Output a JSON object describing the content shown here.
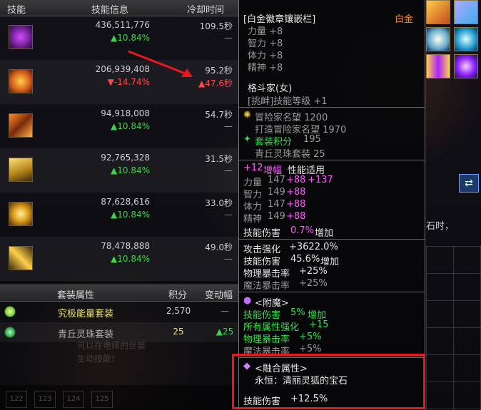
{
  "colors": {
    "accent_green": "#35e04a",
    "accent_red": "#ff4a4a",
    "pink": "#ff5cff",
    "gold": "#e8c35a",
    "highlight": "#e8191e"
  },
  "skill_table": {
    "headers": {
      "skill": "技能",
      "info": "技能信息",
      "cooldown": "冷却时间"
    },
    "rows": [
      {
        "icon": "purple-claw-icon",
        "damage": "436,511,776",
        "pct": "▲10.84%",
        "cd": "109.5秒",
        "cd_change": "—"
      },
      {
        "icon": "fire-burst-icon",
        "damage": "206,939,408",
        "pct": "▼-14.74%",
        "cd": "95.2秒",
        "cd_change": "▲47.6秒"
      },
      {
        "icon": "flame-fist-icon",
        "damage": "94,918,008",
        "pct": "▲10.84%",
        "cd": "54.7秒",
        "cd_change": "—"
      },
      {
        "icon": "golden-claw-icon",
        "damage": "92,765,328",
        "pct": "▲10.84%",
        "cd": "31.5秒",
        "cd_change": "—"
      },
      {
        "icon": "sun-star-icon",
        "damage": "87,628,616",
        "pct": "▲10.84%",
        "cd": "33.0秒",
        "cd_change": "—"
      },
      {
        "icon": "golden-strike-icon",
        "damage": "78,478,888",
        "pct": "▲10.84%",
        "cd": "49.0秒",
        "cd_change": "—"
      }
    ]
  },
  "set_table": {
    "headers": {
      "name": "套装属性",
      "score": "积分",
      "change": "变动幅"
    },
    "rows": [
      {
        "icon": "energy-spark-icon",
        "name": "究极能量套装",
        "score": "2,570",
        "change": "—"
      },
      {
        "icon": "fox-gem-icon",
        "name": "青丘灵珠套装",
        "score": "25",
        "change": "▲25"
      }
    ]
  },
  "background_text": {
    "line1": "可以在电师的世装",
    "line2": "生动技能!"
  },
  "bottom_slots": [
    "122",
    "123",
    "124",
    "125"
  ],
  "tooltip": {
    "title": "[白金徽章镶嵌栏]",
    "grade": "白金",
    "base_stats": [
      "力量 +8",
      "智力 +8",
      "体力 +8",
      "精神 +8"
    ],
    "class": "格斗家(女)",
    "skill_level": "[挑衅]技能等级 +1",
    "fame": "冒险家名望 1200",
    "fame2": "打造冒险家名望 1970",
    "set_points_label": "套装积分",
    "set_points_value": "195",
    "set_name": "青丘灵珠套装 25",
    "amp": {
      "prefix": "+12",
      "label": "增幅",
      "suffix": "性能适用"
    },
    "amp_stats": [
      {
        "name": "力量",
        "base": "147",
        "bonus": "+88",
        "bonus2": "+137"
      },
      {
        "name": "智力",
        "base": "149",
        "bonus": "+88",
        "bonus2": ""
      },
      {
        "name": "体力",
        "base": "147",
        "bonus": "+88",
        "bonus2": ""
      },
      {
        "name": "精神",
        "base": "149",
        "bonus": "+88",
        "bonus2": ""
      }
    ],
    "skill_dmg_line": {
      "name": "技能伤害",
      "value": "0.7%",
      "suffix": "增加"
    },
    "attack_lines": [
      {
        "label": "攻击强化",
        "value": "+3622.0%",
        "suffix": ""
      },
      {
        "label": "技能伤害",
        "value": "45.6%",
        "suffix": "增加"
      },
      {
        "label": "物理暴击率",
        "value": "+25%",
        "suffix": ""
      },
      {
        "label": "魔法暴击率",
        "value": "+25%",
        "suffix": ""
      }
    ],
    "enchant_title": "<附魔>",
    "enchant_lines": [
      {
        "label": "技能伤害",
        "value": "5%",
        "suffix": "增加"
      },
      {
        "label": "所有属性强化",
        "value": "+15",
        "suffix": ""
      },
      {
        "label": "物理暴击率",
        "value": "+5%",
        "suffix": ""
      },
      {
        "label": "魔法暴击率",
        "value": "+5%",
        "suffix": ""
      }
    ],
    "fusion_title": "<融合属性>",
    "fusion_gem": "永恒：清丽灵狐的宝石",
    "fusion_stat": {
      "label": "技能伤害",
      "value": "+12.5%"
    }
  },
  "side_text": "石时，",
  "swap_icon": "swap-icon"
}
